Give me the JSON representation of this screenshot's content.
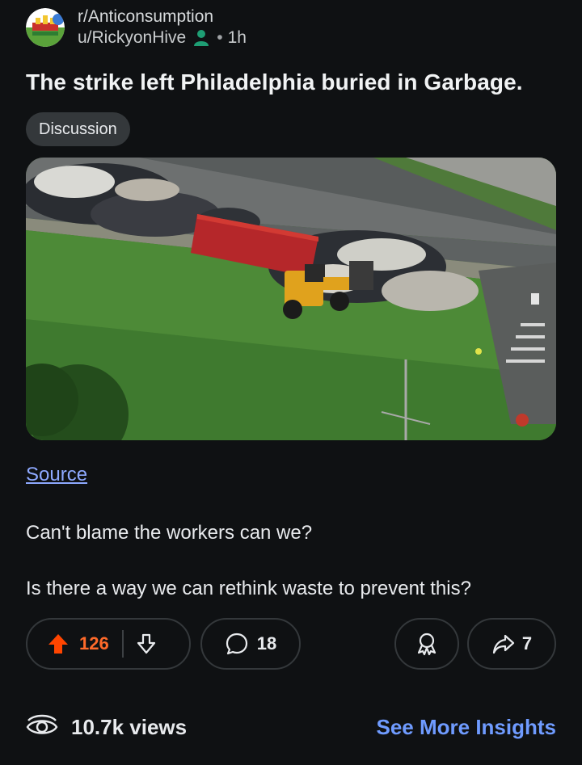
{
  "post": {
    "subreddit": "r/Anticonsumption",
    "author": "u/RickyonHive",
    "separator": "•",
    "age": "1h",
    "title": "The strike left Philadelphia buried in Garbage.",
    "flair": "Discussion",
    "source_link": "Source",
    "body": [
      "Can't blame the workers can we?",
      "Is there a way we can rethink waste to prevent this?"
    ]
  },
  "actions": {
    "upvote_count": "126",
    "comment_count": "18",
    "share_count": "7"
  },
  "footer": {
    "views": "10.7k views",
    "insights_label": "See More Insights"
  },
  "colors": {
    "background": "#0f1113",
    "upvote_active": "#ff4500",
    "link": "#8ea9ff",
    "insights": "#6f9bff",
    "flair_bg": "#34383b"
  },
  "icons": [
    "subreddit-avatar-icon",
    "user-flair-icon",
    "upvote-icon",
    "downvote-icon",
    "comment-icon",
    "award-icon",
    "share-icon",
    "views-icon"
  ]
}
